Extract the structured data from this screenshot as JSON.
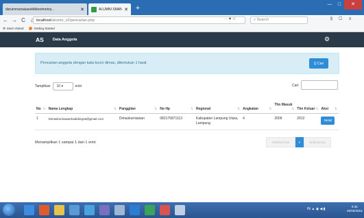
{
  "browser": {
    "tabs": [
      {
        "label": "daruinmarsaiusa4dikwoimetoy..."
      },
      {
        "label": "ALUMNI SMANSAKURA"
      }
    ],
    "new_tab": "+",
    "window_controls": {
      "minimize": "—",
      "maximize": "□",
      "close": "✕"
    },
    "nav": {
      "back": "←",
      "forward": "→",
      "reload": "C",
      "home": "⌂"
    },
    "url_host": "localhost",
    "url_path": "/alumni_v2/pencarian.php",
    "url_icons": "··· ♥ ☆",
    "search_placeholder": "Search",
    "toolbar_icons": "⫼ ▢ ≡",
    "bookmarks": [
      "Most Visited",
      "Getting Started"
    ]
  },
  "app": {
    "brand": "AS",
    "menu_label": "Data Anggota",
    "settings_icon": "gear-icon"
  },
  "alert": {
    "message": "Pencarian anggota dengan kata kunci dimas, ditemukan 1 hasil.",
    "button_label": "Q Cari"
  },
  "table_controls": {
    "show_label": "Tampilkan",
    "show_value": "10",
    "entries_label": "entri",
    "search_label": "Cari:"
  },
  "table": {
    "headers": [
      "No",
      "Nama Lengkap",
      "Panggilan",
      "No Hp",
      "Regional",
      "Angkatan",
      "Thn Masuk",
      "Thn Keluar",
      "Aksi"
    ],
    "rows": [
      {
        "no": "1",
        "nama": "Dimaskurniawanhadidingrat@gmail.com",
        "panggilan": "Dimaskurniawan",
        "hp": "082175871113",
        "regional": "Kabupaten Lampung Utara, Lampung",
        "angkatan": "4",
        "masuk": "2009",
        "keluar": "2012",
        "aksi": "Detail"
      }
    ]
  },
  "footer": {
    "info": "Menampilkan 1 sampai 1 dari 1 entri",
    "prev": "Sebelumnya",
    "page": "1",
    "next": "Selanjutnya"
  },
  "taskbar": {
    "tray": "IN ▲ ◉ ◀ ▮",
    "time": "9:45",
    "date": "26/05/2016"
  },
  "colors": {
    "header_bg": "#2b3a48",
    "alert_bg": "#d9edf7",
    "primary": "#2f8dd7",
    "taskbar": "#2a5590"
  }
}
